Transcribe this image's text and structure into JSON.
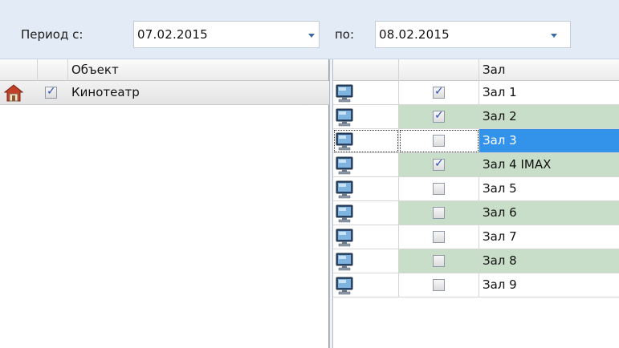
{
  "toolbar": {
    "period_from_label": "Период с:",
    "date_from": "07.02.2015",
    "period_to_label": "по:",
    "date_to": "08.02.2015"
  },
  "objects_grid": {
    "header": {
      "object": "Объект"
    },
    "rows": [
      {
        "icon": "house-icon",
        "checked": true,
        "name": "Кинотеатр"
      }
    ]
  },
  "halls_grid": {
    "header": {
      "hall": "Зал"
    },
    "rows": [
      {
        "icon": "monitor-icon",
        "checked": true,
        "name": "Зал 1",
        "style": "normal"
      },
      {
        "icon": "monitor-icon",
        "checked": true,
        "name": "Зал 2",
        "style": "alt"
      },
      {
        "icon": "monitor-icon",
        "checked": false,
        "name": "Зал 3",
        "style": "selected"
      },
      {
        "icon": "monitor-icon",
        "checked": true,
        "name": "Зал 4 IMAX",
        "style": "alt"
      },
      {
        "icon": "monitor-icon",
        "checked": false,
        "name": "Зал 5",
        "style": "normal"
      },
      {
        "icon": "monitor-icon",
        "checked": false,
        "name": "Зал 6",
        "style": "alt"
      },
      {
        "icon": "monitor-icon",
        "checked": false,
        "name": "Зал 7",
        "style": "normal"
      },
      {
        "icon": "monitor-icon",
        "checked": false,
        "name": "Зал 8",
        "style": "alt"
      },
      {
        "icon": "monitor-icon",
        "checked": false,
        "name": "Зал 9",
        "style": "normal"
      }
    ]
  },
  "colors": {
    "toolbar_bg": "#e3ecf6",
    "alt_row": "#c9dec8",
    "selection": "#3392ea",
    "check": "#2a4fb3"
  }
}
